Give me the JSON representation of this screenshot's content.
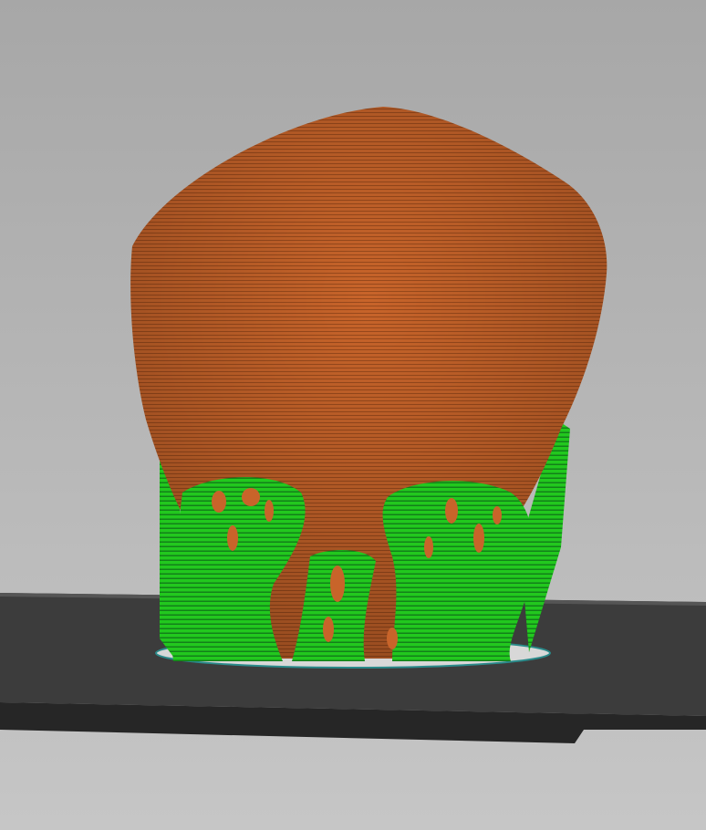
{
  "viewport": {
    "colors": {
      "background_top": "#a7a7a7",
      "background_bottom": "#c6c6c6",
      "bed_top": "#3c3c3c",
      "bed_edge": "#262626",
      "model": "#c8642a",
      "model_stripe": "#9a4a1c",
      "support": "#22c81e",
      "support_dark": "#13801a",
      "skirt": "#2a8a8a"
    }
  }
}
